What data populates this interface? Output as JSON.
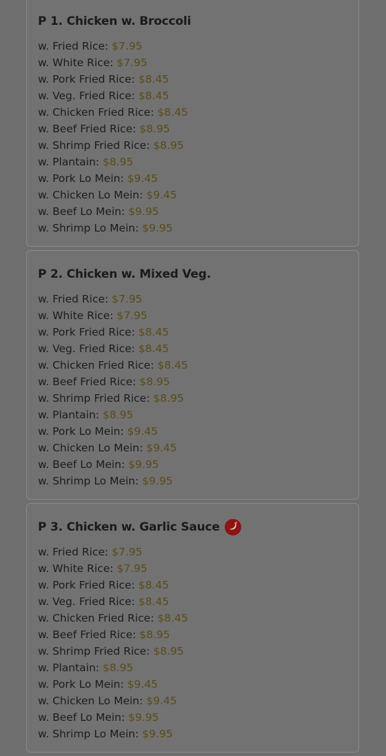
{
  "accent_colors": {
    "price": "#5b4a17",
    "title": "#1b1b1b",
    "hot_icon": "#8e1313"
  },
  "menu": {
    "items": [
      {
        "title": "P 1. Chicken w. Broccoli",
        "spicy": false,
        "prices": [
          {
            "option": "w. Fried Rice:",
            "price": "$7.95"
          },
          {
            "option": "w. White Rice:",
            "price": "$7.95"
          },
          {
            "option": "w. Pork Fried Rice:",
            "price": "$8.45"
          },
          {
            "option": "w. Veg. Fried Rice:",
            "price": "$8.45"
          },
          {
            "option": "w. Chicken Fried Rice:",
            "price": "$8.45"
          },
          {
            "option": "w. Beef Fried Rice:",
            "price": "$8.95"
          },
          {
            "option": "w. Shrimp Fried Rice:",
            "price": "$8.95"
          },
          {
            "option": "w. Plantain:",
            "price": "$8.95"
          },
          {
            "option": "w. Pork Lo Mein:",
            "price": "$9.45"
          },
          {
            "option": "w. Chicken Lo Mein:",
            "price": "$9.45"
          },
          {
            "option": "w. Beef Lo Mein:",
            "price": "$9.95"
          },
          {
            "option": "w. Shrimp Lo Mein:",
            "price": "$9.95"
          }
        ]
      },
      {
        "title": "P 2. Chicken w. Mixed Veg.",
        "spicy": false,
        "prices": [
          {
            "option": "w. Fried Rice:",
            "price": "$7.95"
          },
          {
            "option": "w. White Rice:",
            "price": "$7.95"
          },
          {
            "option": "w. Pork Fried Rice:",
            "price": "$8.45"
          },
          {
            "option": "w. Veg. Fried Rice:",
            "price": "$8.45"
          },
          {
            "option": "w. Chicken Fried Rice:",
            "price": "$8.45"
          },
          {
            "option": "w. Beef Fried Rice:",
            "price": "$8.95"
          },
          {
            "option": "w. Shrimp Fried Rice:",
            "price": "$8.95"
          },
          {
            "option": "w. Plantain:",
            "price": "$8.95"
          },
          {
            "option": "w. Pork Lo Mein:",
            "price": "$9.45"
          },
          {
            "option": "w. Chicken Lo Mein:",
            "price": "$9.45"
          },
          {
            "option": "w. Beef Lo Mein:",
            "price": "$9.95"
          },
          {
            "option": "w. Shrimp Lo Mein:",
            "price": "$9.95"
          }
        ]
      },
      {
        "title": "P 3. Chicken w. Garlic Sauce",
        "spicy": true,
        "icon": "hot-pepper-icon",
        "prices": [
          {
            "option": "w. Fried Rice:",
            "price": "$7.95"
          },
          {
            "option": "w. White Rice:",
            "price": "$7.95"
          },
          {
            "option": "w. Pork Fried Rice:",
            "price": "$8.45"
          },
          {
            "option": "w. Veg. Fried Rice:",
            "price": "$8.45"
          },
          {
            "option": "w. Chicken Fried Rice:",
            "price": "$8.45"
          },
          {
            "option": "w. Beef Fried Rice:",
            "price": "$8.95"
          },
          {
            "option": "w. Shrimp Fried Rice:",
            "price": "$8.95"
          },
          {
            "option": "w. Plantain:",
            "price": "$8.95"
          },
          {
            "option": "w. Pork Lo Mein:",
            "price": "$9.45"
          },
          {
            "option": "w. Chicken Lo Mein:",
            "price": "$9.45"
          },
          {
            "option": "w. Beef Lo Mein:",
            "price": "$9.95"
          },
          {
            "option": "w. Shrimp Lo Mein:",
            "price": "$9.95"
          }
        ]
      }
    ]
  }
}
